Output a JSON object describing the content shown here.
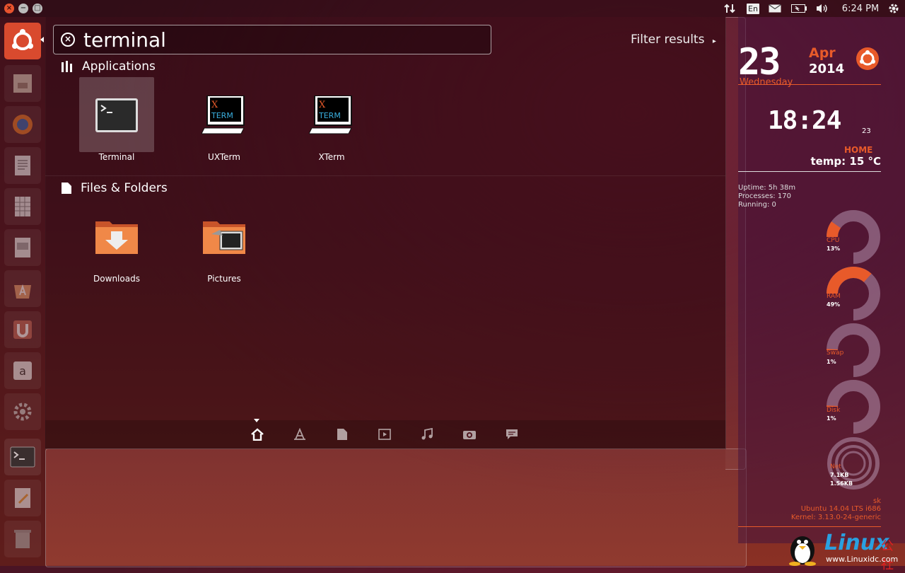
{
  "panel": {
    "time": "6:24 PM",
    "keyboard": "En"
  },
  "search": {
    "query": "terminal",
    "filter_label": "Filter results"
  },
  "categories": {
    "applications": {
      "title": "Applications",
      "items": [
        {
          "label": "Terminal"
        },
        {
          "label": "UXTerm"
        },
        {
          "label": "XTerm"
        }
      ]
    },
    "files": {
      "title": "Files & Folders",
      "items": [
        {
          "label": "Downloads"
        },
        {
          "label": "Pictures"
        }
      ]
    }
  },
  "xterm_icon": {
    "x": "X",
    "term": "TERM"
  },
  "lenses": [
    "home-icon",
    "applications-icon",
    "files-icon",
    "video-icon",
    "music-icon",
    "photos-icon",
    "social-icon"
  ],
  "conky": {
    "day": "23",
    "month": "Apr",
    "year": "2014",
    "weekday": "Wednesday",
    "time": "18:24",
    "seconds": "23",
    "location": "HOME",
    "temp": "temp: 15 °C",
    "uptime": "Uptime: 5h 38m",
    "processes": "Processes: 170",
    "running": "Running: 0",
    "cpu": {
      "label": "CPU",
      "value": "13%",
      "fraction": 0.13
    },
    "ram": {
      "label": "RAM",
      "value": "49%",
      "fraction": 0.49
    },
    "swap": {
      "label": "Swap",
      "value": "1%",
      "fraction": 0.01
    },
    "disk": {
      "label": "Disk",
      "value": "1%",
      "fraction": 0.01
    },
    "net": {
      "label": "Net",
      "up": "7.1KB",
      "down": "1.56KB"
    },
    "user": "sk",
    "distro": "Ubuntu 14.04 LTS  i686",
    "kernel": "Kernel: 3.13.0-24-generic"
  },
  "watermark": {
    "brand": "Linux",
    "cn": "公社",
    "url": "www.Linuxidc.com"
  },
  "colors": {
    "accent": "#e85a2a",
    "launcher_active": "#d94a2e"
  }
}
